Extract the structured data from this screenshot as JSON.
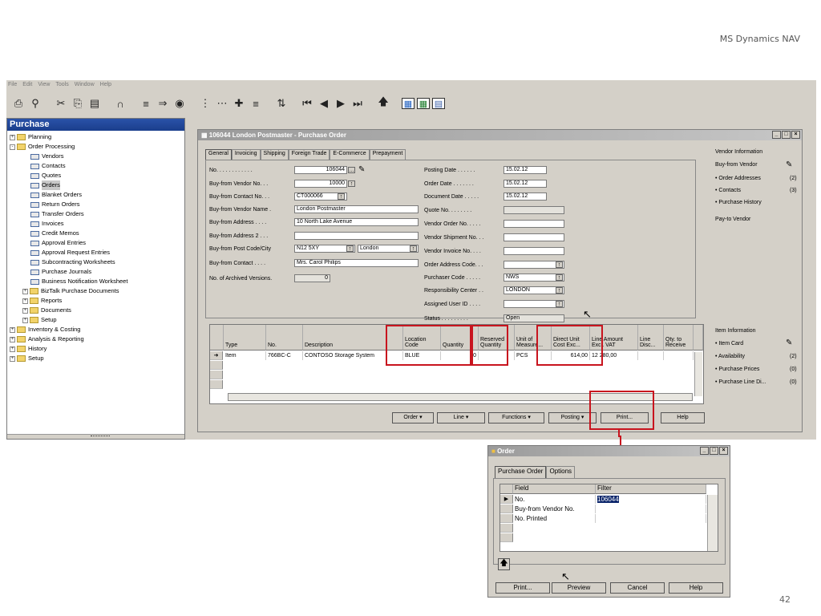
{
  "slide": {
    "brand": "MS Dynamics NAV",
    "page_number": "42"
  },
  "menu": [
    "File",
    "Edit",
    "View",
    "Tools",
    "Window",
    "Help"
  ],
  "toolbar": [
    "print-icon",
    "print-preview-icon",
    "cut-icon",
    "copy-icon",
    "paste-icon",
    "attach-icon",
    "filter-icon",
    "flowfilter-icon",
    "find-icon",
    "list-icon",
    "table-icon",
    "insert-icon",
    "delete-icon",
    "sort-icon",
    "first-icon",
    "previous-icon",
    "next-icon",
    "last-icon",
    "up-icon",
    "report-icon",
    "excel-icon",
    "chart-icon"
  ],
  "nav": {
    "title": "Purchase",
    "items": [
      {
        "label": "Planning",
        "type": "folder",
        "level": 0,
        "toggle": "+"
      },
      {
        "label": "Order Processing",
        "type": "folder",
        "level": 0,
        "toggle": "-"
      },
      {
        "label": "Vendors",
        "type": "form",
        "level": 1
      },
      {
        "label": "Contacts",
        "type": "form",
        "level": 1
      },
      {
        "label": "Quotes",
        "type": "form",
        "level": 1
      },
      {
        "label": "Orders",
        "type": "form",
        "level": 1,
        "selected": true
      },
      {
        "label": "Blanket Orders",
        "type": "form",
        "level": 1
      },
      {
        "label": "Return Orders",
        "type": "form",
        "level": 1
      },
      {
        "label": "Transfer Orders",
        "type": "form",
        "level": 1
      },
      {
        "label": "Invoices",
        "type": "form",
        "level": 1
      },
      {
        "label": "Credit Memos",
        "type": "form",
        "level": 1
      },
      {
        "label": "Approval Entries",
        "type": "form",
        "level": 1
      },
      {
        "label": "Approval Request Entries",
        "type": "form",
        "level": 1
      },
      {
        "label": "Subcontracting Worksheets",
        "type": "form",
        "level": 1
      },
      {
        "label": "Purchase Journals",
        "type": "form",
        "level": 1
      },
      {
        "label": "Business Notification Worksheet",
        "type": "form",
        "level": 1
      },
      {
        "label": "BizTalk Purchase Documents",
        "type": "folder",
        "level": 1,
        "toggle": "+"
      },
      {
        "label": "Reports",
        "type": "folder",
        "level": 1,
        "toggle": "+"
      },
      {
        "label": "Documents",
        "type": "folder",
        "level": 1,
        "toggle": "+"
      },
      {
        "label": "Setup",
        "type": "folder",
        "level": 1,
        "toggle": "+"
      },
      {
        "label": "Inventory & Costing",
        "type": "folder",
        "level": 0,
        "toggle": "+"
      },
      {
        "label": "Analysis & Reporting",
        "type": "folder",
        "level": 0,
        "toggle": "+"
      },
      {
        "label": "History",
        "type": "folder",
        "level": 0,
        "toggle": "+"
      },
      {
        "label": "Setup",
        "type": "folder",
        "level": 0,
        "toggle": "+"
      }
    ]
  },
  "po": {
    "title": "106044 London Postmaster - Purchase Order",
    "tabs": [
      "General",
      "Invoicing",
      "Shipping",
      "Foreign Trade",
      "E-Commerce",
      "Prepayment"
    ],
    "left_fields": [
      {
        "label": "No. . . . . . . . . . . .",
        "value": "106044"
      },
      {
        "label": "Buy-from Vendor No. . .",
        "value": "10000"
      },
      {
        "label": "Buy-from Contact No. . .",
        "value": "CT000066"
      },
      {
        "label": "Buy-from Vendor Name .",
        "value": "London Postmaster"
      },
      {
        "label": "Buy-from Address . . . .",
        "value": "10 North Lake Avenue"
      },
      {
        "label": "Buy-from Address 2 . . .",
        "value": ""
      },
      {
        "label": "Buy-from Post Code/City",
        "value": "N12 5XY",
        "value2": "London"
      },
      {
        "label": "Buy-from Contact . . . .",
        "value": "Mrs. Carol Philips"
      },
      {
        "label": "No. of Archived Versions.",
        "value": "0"
      }
    ],
    "right_fields": [
      {
        "label": "Posting Date . . . . . .",
        "value": "15.02.12"
      },
      {
        "label": "Order Date . . . . . . .",
        "value": "15.02.12"
      },
      {
        "label": "Document Date . . . . .",
        "value": "15.02.12"
      },
      {
        "label": "Quote No. . . . . . . .",
        "value": ""
      },
      {
        "label": "Vendor Order No. . . . .",
        "value": ""
      },
      {
        "label": "Vendor Shipment No. . .",
        "value": ""
      },
      {
        "label": "Vendor Invoice No. . . .",
        "value": ""
      },
      {
        "label": "Order Address Code. . .",
        "value": ""
      },
      {
        "label": "Purchaser Code . . . . .",
        "value": "NWS"
      },
      {
        "label": "Responsibility Center . .",
        "value": "LONDON"
      },
      {
        "label": "Assigned User ID . . . .",
        "value": ""
      },
      {
        "label": "Status . . . . . . . . .",
        "value": "Open"
      }
    ],
    "vendor_info": {
      "title": "Vendor Information",
      "items": [
        {
          "label": "Buy-from Vendor",
          "count": ""
        },
        {
          "label": "Order Addresses",
          "count": "(2)"
        },
        {
          "label": "Contacts",
          "count": "(3)"
        },
        {
          "label": "Purchase History",
          "count": ""
        },
        {
          "label": "Pay-to Vendor",
          "count": ""
        }
      ]
    },
    "item_info": {
      "title": "Item Information",
      "items": [
        {
          "label": "Item Card",
          "count": ""
        },
        {
          "label": "Availability",
          "count": "(2)"
        },
        {
          "label": "Purchase Prices",
          "count": "(0)"
        },
        {
          "label": "Purchase Line Di...",
          "count": "(0)"
        }
      ]
    },
    "lines": {
      "headers": [
        "Type",
        "No.",
        "Description",
        "Location Code",
        "Quantity",
        "Reserved Quantity",
        "Unit of Measure...",
        "Direct Unit Cost Exc...",
        "Line Amount Excl. VAT",
        "Line Disc...",
        "Qty. to Receive"
      ],
      "row": [
        "Item",
        "766BC-C",
        "CONTOSO Storage System",
        "BLUE",
        "20",
        "",
        "PCS",
        "614,00",
        "12 280,00",
        "",
        ""
      ]
    },
    "buttons": [
      "Order",
      "Line",
      "Functions",
      "Posting",
      "Print...",
      "Help"
    ]
  },
  "dialog": {
    "title": "Order",
    "tabs": [
      "Purchase Order",
      "Options"
    ],
    "columns": [
      "Field",
      "Filter"
    ],
    "rows": [
      {
        "field": "No.",
        "filter": "106044"
      },
      {
        "field": "Buy-from Vendor No.",
        "filter": ""
      },
      {
        "field": "No. Printed",
        "filter": ""
      }
    ],
    "buttons": [
      "Print...",
      "Preview",
      "Cancel",
      "Help"
    ]
  },
  "colors": {
    "highlight": "#c8141e",
    "nav_header": "#2a52a8"
  }
}
